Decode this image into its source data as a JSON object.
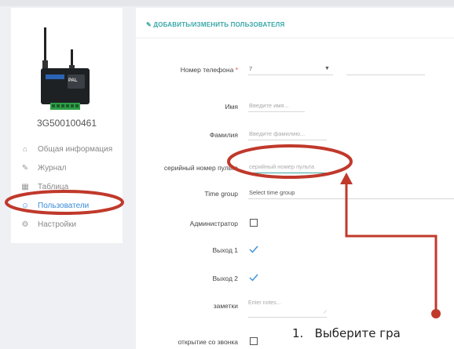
{
  "sidebar": {
    "device_id": "3G500100461",
    "device_brand": "PAL",
    "items": [
      {
        "icon": "home-icon",
        "label": "Общая информация"
      },
      {
        "icon": "journal-icon",
        "label": "Журнал"
      },
      {
        "icon": "table-icon",
        "label": "Таблица"
      },
      {
        "icon": "user-icon",
        "label": "Пользователи",
        "active": true
      },
      {
        "icon": "gear-icon",
        "label": "Настройки"
      }
    ]
  },
  "panel": {
    "title": "ДОБАВИТЬ/ИЗМЕНИТЬ ПОЛЬЗОВАТЕЛЯ",
    "fields": {
      "phone": {
        "label": "Номер телефона",
        "value": "7"
      },
      "name": {
        "label": "Имя",
        "placeholder": "Введите имя..."
      },
      "surname": {
        "label": "Фамилия",
        "placeholder": "Введите фамилию..."
      },
      "serial": {
        "label": "серийный номер пульта",
        "placeholder": "серийный номер пульта"
      },
      "timegroup": {
        "label": "Time group",
        "placeholder": "Select time group"
      },
      "admin": {
        "label": "Администратор"
      },
      "output1": {
        "label": "Выход 1"
      },
      "output2": {
        "label": "Выход 2"
      },
      "notes": {
        "label": "заметки",
        "placeholder": "Enter notes..."
      },
      "callopen": {
        "label": "открытие со звонка"
      }
    }
  },
  "annotation": {
    "caption_number": "1.",
    "caption_text": "Выберите гра",
    "color": "#c0392b"
  }
}
